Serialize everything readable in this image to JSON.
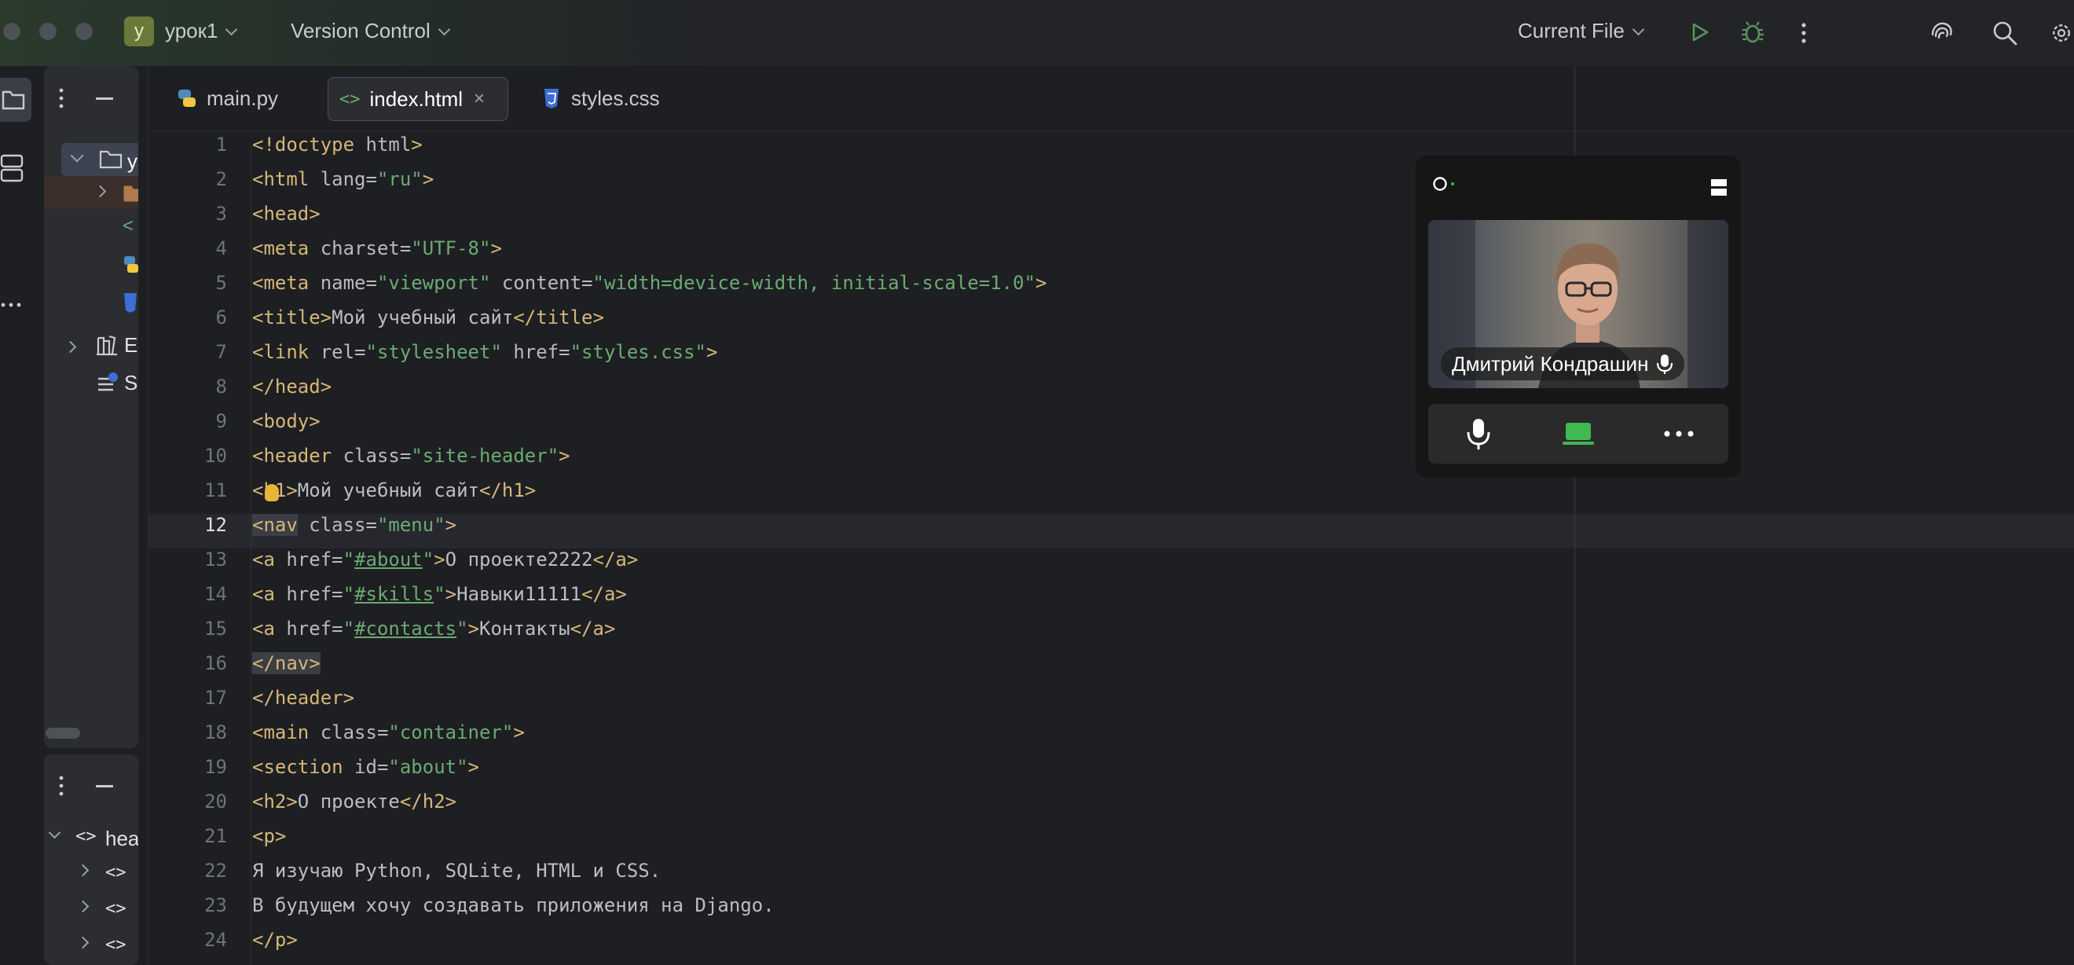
{
  "titlebar": {
    "project_initial": "у",
    "project_name": "урок1",
    "vcs_label": "Version Control",
    "run_config": "Current File"
  },
  "sidebar": {
    "tree_root_label": "у",
    "tree_item_e": "E",
    "tree_item_s": "S",
    "structure_root": "hea"
  },
  "tabs": [
    {
      "label": "main.py",
      "icon": "python-icon"
    },
    {
      "label": "index.html",
      "icon": "html-icon"
    },
    {
      "label": "styles.css",
      "icon": "css-icon"
    }
  ],
  "editor": {
    "current_line": 12,
    "line_numbers": [
      "1",
      "2",
      "3",
      "4",
      "5",
      "6",
      "7",
      "8",
      "9",
      "10",
      "11",
      "12",
      "13",
      "14",
      "15",
      "16",
      "17",
      "18",
      "19",
      "20",
      "21",
      "22",
      "23",
      "24"
    ]
  },
  "code": {
    "l1": {
      "t1": "<!doctype",
      "a1": " html",
      "t2": ">"
    },
    "l2": {
      "t1": "<html",
      "a1": " lang=",
      "s1": "\"ru\"",
      "t2": ">"
    },
    "l3": {
      "t1": "<head>"
    },
    "l4": {
      "t1": "<meta",
      "a1": " charset=",
      "s1": "\"UTF-8\"",
      "t2": ">"
    },
    "l5": {
      "t1": "<meta",
      "a1": " name=",
      "s1": "\"viewport\"",
      "a2": " content=",
      "s2": "\"width=device-width, initial-scale=1.0\"",
      "t2": ">"
    },
    "l6": {
      "t1": "<title>",
      "x1": "Мой учебный сайт",
      "t2": "</title>"
    },
    "l7": {
      "t1": "<link",
      "a1": " rel=",
      "s1": "\"stylesheet\"",
      "a2": " href=",
      "s2": "\"styles.css\"",
      "t2": ">"
    },
    "l8": {
      "t1": "</head>"
    },
    "l9": {
      "t1": "<body>"
    },
    "l10": {
      "t1": "<header",
      "a1": " class=",
      "s1": "\"site-header\"",
      "t2": ">"
    },
    "l11": {
      "t1": "<h1>",
      "x1": "Мой учебный сайт",
      "t2": "</h1>"
    },
    "l12": {
      "t1": "<nav",
      "a1": " class=",
      "s1": "\"menu\"",
      "t2": ">"
    },
    "l13": {
      "t1": "<a",
      "a1": " href=",
      "q1": "\"",
      "u1": "#about",
      "q2": "\"",
      "t2": ">",
      "x1": "О проекте2222",
      "t3": "</a>"
    },
    "l14": {
      "t1": "<a",
      "a1": " href=",
      "q1": "\"",
      "u1": "#skills",
      "q2": "\"",
      "t2": ">",
      "x1": "Навыки11111",
      "t3": "</a>"
    },
    "l15": {
      "t1": "<a",
      "a1": " href=",
      "q1": "\"",
      "u1": "#contacts",
      "q2": "\"",
      "t2": ">",
      "x1": "Контакты",
      "t3": "</a>"
    },
    "l16": {
      "t1": "</nav>"
    },
    "l17": {
      "t1": "</header>"
    },
    "l18": {
      "t1": "<main",
      "a1": " class=",
      "s1": "\"container\"",
      "t2": ">"
    },
    "l19": {
      "t1": "<section",
      "a1": " id=",
      "s1": "\"about\"",
      "t2": ">"
    },
    "l20": {
      "t1": "<h2>",
      "x1": "О проекте",
      "t2": "</h2>"
    },
    "l21": {
      "t1": "<p>"
    },
    "l22": {
      "x1": "Я изучаю Python, SQLite, HTML и CSS."
    },
    "l23": {
      "x1": "В будущем хочу создавать приложения на Django."
    },
    "l24": {
      "t1": "</p>"
    }
  },
  "video_call": {
    "participant_name": "Дмитрий Кондрашин",
    "accent_green": "#3fb950"
  }
}
